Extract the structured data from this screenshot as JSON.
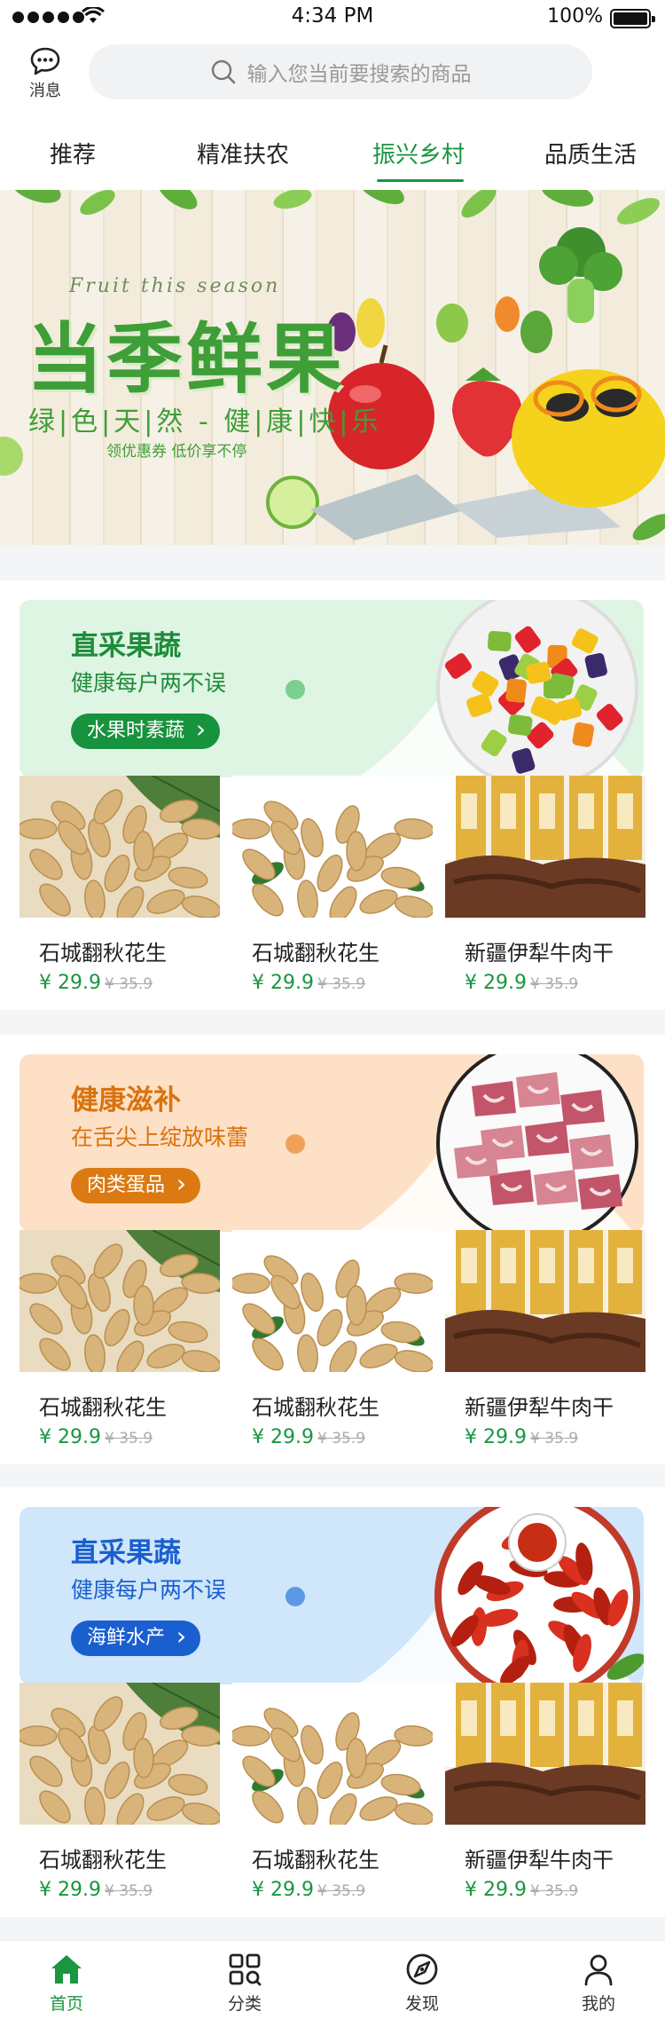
{
  "status_bar": {
    "time": "4:34 PM",
    "battery": "100%"
  },
  "header": {
    "message_label": "消息",
    "search_placeholder": "输入您当前要搜索的商品"
  },
  "tabs": [
    {
      "label": "推荐"
    },
    {
      "label": "精准扶农"
    },
    {
      "label": "振兴乡村",
      "active": true
    },
    {
      "label": "品质生活"
    }
  ],
  "banner": {
    "script": "Fruit this season",
    "title": "当季鲜果",
    "subtitle": "绿|色|天|然 - 健|康|快|乐",
    "small": "领优惠券 低价享不停"
  },
  "sections": [
    {
      "title": "直采果蔬",
      "subtitle": "健康每户两不误",
      "button": "水果时素蔬",
      "theme": {
        "bg": "#dff5e3",
        "title": "#1e8c3a",
        "btn": "#17923d",
        "dot": "#7ccf8e"
      },
      "image": "fruit-salad-bowl",
      "products": [
        {
          "name": "石城翻秋花生",
          "price": "¥ 29.9",
          "original": "¥ 35.9",
          "image": "peanuts-with-leaves"
        },
        {
          "name": "石城翻秋花生",
          "price": "¥ 29.9",
          "original": "¥ 35.9",
          "image": "peanuts-pile"
        },
        {
          "name": "新疆伊犁牛肉干",
          "price": "¥ 29.9",
          "original": "¥ 35.9",
          "image": "beef-jerky-packs"
        }
      ]
    },
    {
      "title": "健康滋补",
      "subtitle": "在舌尖上绽放味蕾",
      "button": "肉类蛋品",
      "theme": {
        "bg": "#fde0c6",
        "title": "#d9730f",
        "btn": "#db7a12",
        "dot": "#f1a05a"
      },
      "image": "raw-meat-plate",
      "products": [
        {
          "name": "石城翻秋花生",
          "price": "¥ 29.9",
          "original": "¥ 35.9",
          "image": "peanuts-with-leaves"
        },
        {
          "name": "石城翻秋花生",
          "price": "¥ 29.9",
          "original": "¥ 35.9",
          "image": "peanuts-pile"
        },
        {
          "name": "新疆伊犁牛肉干",
          "price": "¥ 29.9",
          "original": "¥ 35.9",
          "image": "beef-jerky-packs"
        }
      ]
    },
    {
      "title": "直采果蔬",
      "subtitle": "健康每户两不误",
      "button": "海鲜水产",
      "theme": {
        "bg": "#cfe6fb",
        "title": "#1a5fcf",
        "btn": "#1a5fcf",
        "dot": "#5d98e6"
      },
      "image": "crayfish-plate",
      "products": [
        {
          "name": "石城翻秋花生",
          "price": "¥ 29.9",
          "original": "¥ 35.9",
          "image": "peanuts-with-leaves"
        },
        {
          "name": "石城翻秋花生",
          "price": "¥ 29.9",
          "original": "¥ 35.9",
          "image": "peanuts-pile"
        },
        {
          "name": "新疆伊犁牛肉干",
          "price": "¥ 29.9",
          "original": "¥ 35.9",
          "image": "beef-jerky-packs"
        }
      ]
    }
  ],
  "tabbar": [
    {
      "label": "首页",
      "icon": "home-icon",
      "active": true
    },
    {
      "label": "分类",
      "icon": "category-icon"
    },
    {
      "label": "发现",
      "icon": "discover-icon"
    },
    {
      "label": "我的",
      "icon": "profile-icon"
    }
  ],
  "colors": {
    "accent": "#1a9640"
  }
}
